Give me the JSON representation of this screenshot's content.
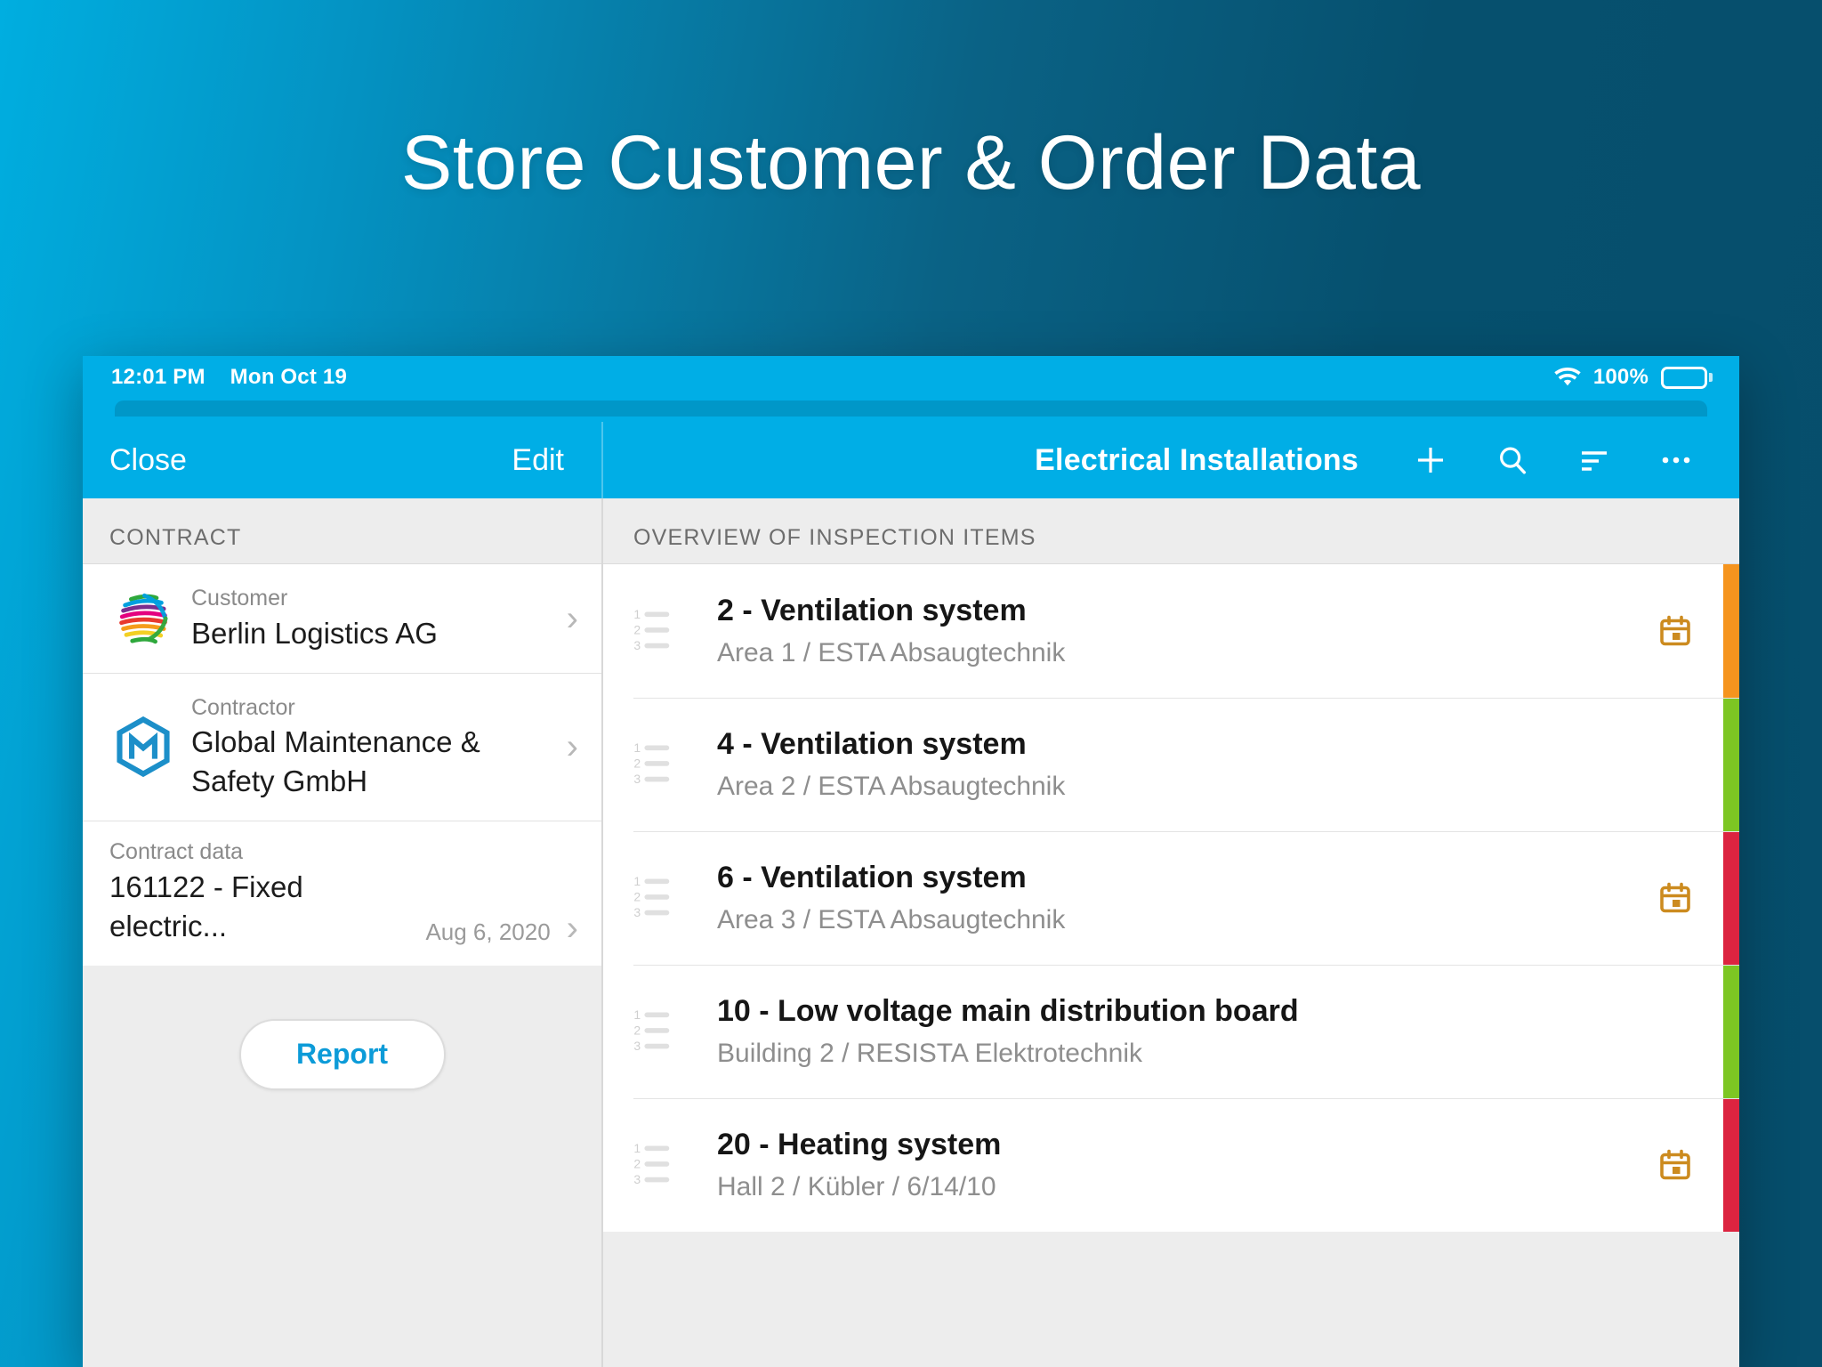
{
  "hero": {
    "title": "Store Customer & Order Data"
  },
  "device": {
    "status_bar": {
      "time": "12:01 PM",
      "date": "Mon Oct 19",
      "wifi_icon": "wifi-icon",
      "battery_percent": "100%",
      "battery_icon": "battery-full-icon"
    }
  },
  "nav": {
    "close_label": "Close",
    "edit_label": "Edit",
    "title": "Electrical Installations",
    "actions": [
      {
        "name": "add-icon",
        "glyph": "+"
      },
      {
        "name": "search-icon",
        "glyph": "search"
      },
      {
        "name": "sort-icon",
        "glyph": "sort"
      },
      {
        "name": "more-options-icon",
        "glyph": "..."
      }
    ]
  },
  "sidebar": {
    "section_title": "CONTRACT",
    "rows": [
      {
        "label": "Customer",
        "value": "Berlin Logistics AG",
        "logo": "rainbow-globe-logo",
        "meta": "",
        "chevron": "chevron-right-icon"
      },
      {
        "label": "Contractor",
        "value": "Global Maintenance & Safety GmbH",
        "logo": "hexagon-m-logo",
        "meta": "",
        "chevron": "chevron-right-icon"
      }
    ],
    "contract_data": {
      "label": "Contract data",
      "value": "161122 - Fixed electric...",
      "date": "Aug 6, 2020",
      "chevron": "chevron-right-icon"
    },
    "report_label": "Report"
  },
  "main": {
    "section_title": "OVERVIEW OF INSPECTION ITEMS",
    "items": [
      {
        "title": "2 - Ventilation system",
        "subtitle": "Area 1 / ESTA Absaugtechnik",
        "icon": "numbered-list-icon",
        "has_calendar": true,
        "calendar_icon": "calendar-icon",
        "status_color": "#F5941E"
      },
      {
        "title": "4 - Ventilation system",
        "subtitle": "Area 2 / ESTA Absaugtechnik",
        "icon": "numbered-list-icon",
        "has_calendar": false,
        "calendar_icon": "",
        "status_color": "#7DC623"
      },
      {
        "title": "6 - Ventilation system",
        "subtitle": "Area 3 / ESTA Absaugtechnik",
        "icon": "numbered-list-icon",
        "has_calendar": true,
        "calendar_icon": "calendar-icon",
        "status_color": "#DC2440"
      },
      {
        "title": "10 - Low voltage main distribution board",
        "subtitle": "Building 2 / RESISTA Elektrotechnik",
        "icon": "numbered-list-icon",
        "has_calendar": false,
        "calendar_icon": "",
        "status_color": "#7DC623"
      },
      {
        "title": "20 - Heating system",
        "subtitle": "Hall 2 / Kübler / 6/14/10",
        "icon": "numbered-list-icon",
        "has_calendar": true,
        "calendar_icon": "calendar-icon",
        "status_color": "#DC2440"
      }
    ]
  },
  "colors": {
    "brand_cyan": "#00AEE6",
    "accent_blue": "#0C9BD8",
    "page_bg_dark": "#064E6C",
    "status_orange": "#F5941E",
    "status_green": "#7DC623",
    "status_red": "#DC2440",
    "calendar_amber": "#CC8B1F"
  }
}
